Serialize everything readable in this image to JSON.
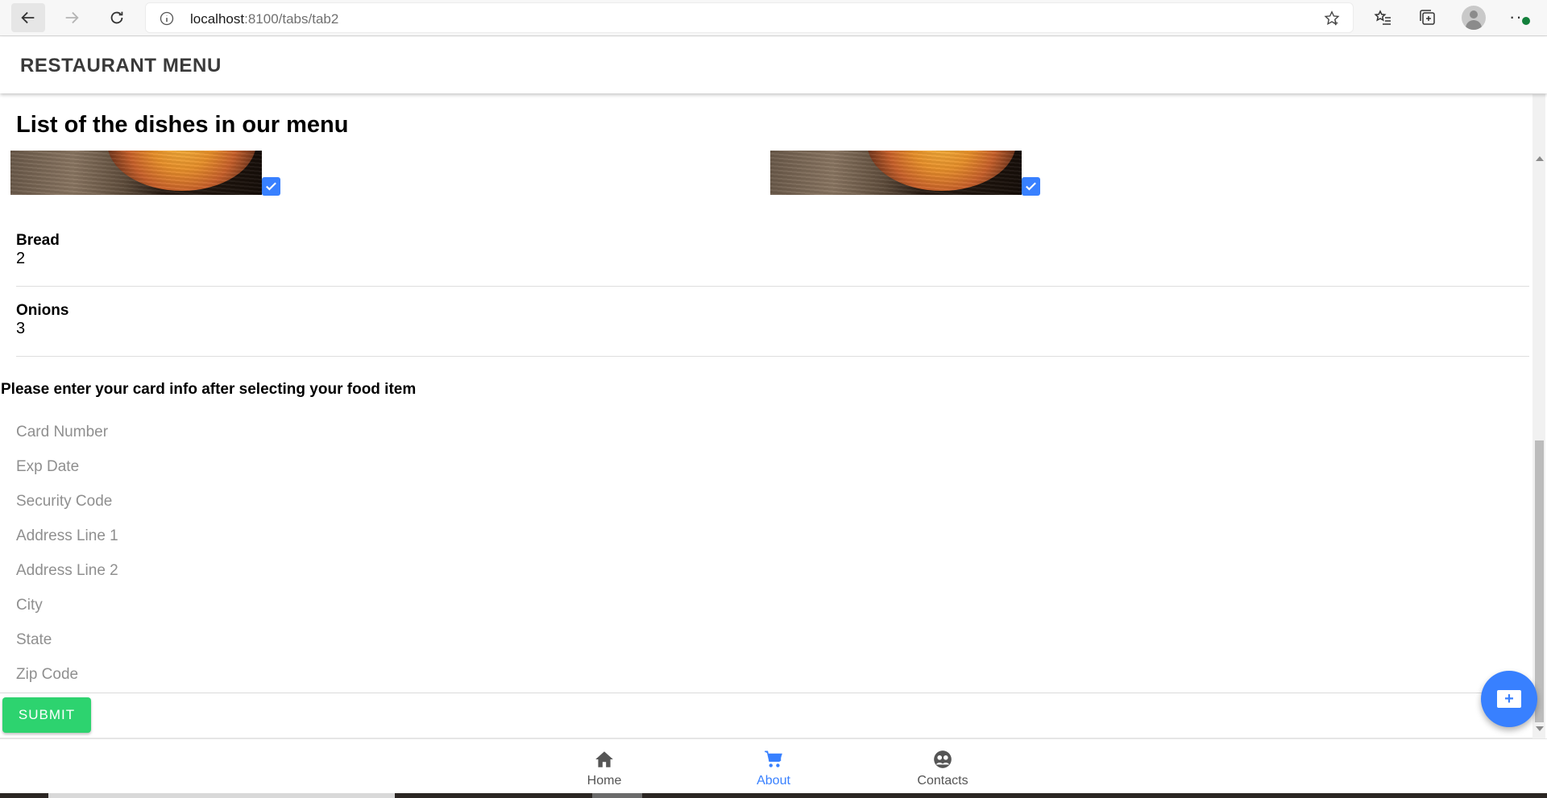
{
  "browser": {
    "url_host": "localhost",
    "url_rest": ":8100/tabs/tab2"
  },
  "app": {
    "title": "RESTAURANT MENU"
  },
  "page": {
    "heading": "List of the dishes in our menu"
  },
  "dishes": [
    {
      "name": "Bread",
      "quantity": "2"
    },
    {
      "name": "Onions",
      "quantity": "3"
    }
  ],
  "form": {
    "prompt": "Please enter your card info after selecting your food item",
    "fields": [
      {
        "placeholder": "Card Number",
        "value": ""
      },
      {
        "placeholder": "Exp Date",
        "value": ""
      },
      {
        "placeholder": "Security Code",
        "value": ""
      },
      {
        "placeholder": "Address Line 1",
        "value": ""
      },
      {
        "placeholder": "Address Line 2",
        "value": ""
      },
      {
        "placeholder": "City",
        "value": ""
      },
      {
        "placeholder": "State",
        "value": ""
      },
      {
        "placeholder": "Zip Code",
        "value": ""
      }
    ],
    "submit_label": "SUBMIT"
  },
  "fab": {
    "label": "+"
  },
  "tabs": [
    {
      "label": "Home",
      "icon": "home-icon",
      "selected": false
    },
    {
      "label": "About",
      "icon": "cart-icon",
      "selected": true
    },
    {
      "label": "Contacts",
      "icon": "people-icon",
      "selected": false
    }
  ],
  "colors": {
    "primary": "#3880ff",
    "success": "#2dd36f",
    "header_text": "#3a3a3a"
  }
}
